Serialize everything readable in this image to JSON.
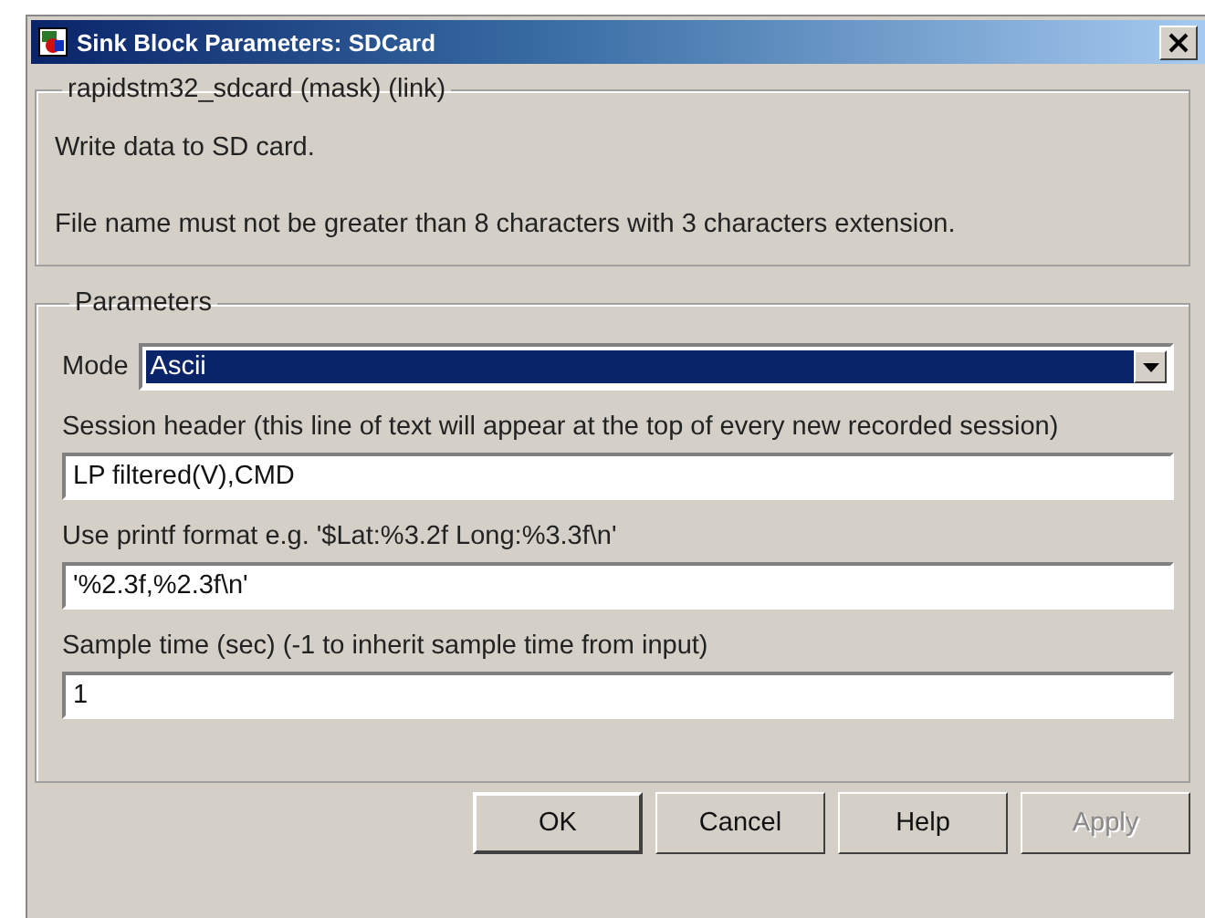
{
  "window": {
    "title": "Sink Block Parameters: SDCard"
  },
  "description": {
    "title": "rapidstm32_sdcard (mask) (link)",
    "lines": [
      "Write data to SD card.",
      "File name must not be greater than 8 characters with 3 characters extension."
    ]
  },
  "parameters": {
    "title": "Parameters",
    "mode": {
      "label": "Mode",
      "value": "Ascii",
      "focused": true
    },
    "fields": [
      {
        "label": "Session header (this line of text will appear at the top of every new recorded session)",
        "value": "LP filtered(V),CMD"
      },
      {
        "label": "Use printf format e.g. '$Lat:%3.2f Long:%3.3f\\n'",
        "value": "'%2.3f,%2.3f\\n'"
      },
      {
        "label": "Sample time (sec) (-1 to inherit sample time from input)",
        "value": "1"
      }
    ]
  },
  "buttons": [
    {
      "label": "OK",
      "default": true,
      "disabled": false
    },
    {
      "label": "Cancel",
      "default": false,
      "disabled": false
    },
    {
      "label": "Help",
      "default": false,
      "disabled": false
    },
    {
      "label": "Apply",
      "default": false,
      "disabled": true
    }
  ]
}
